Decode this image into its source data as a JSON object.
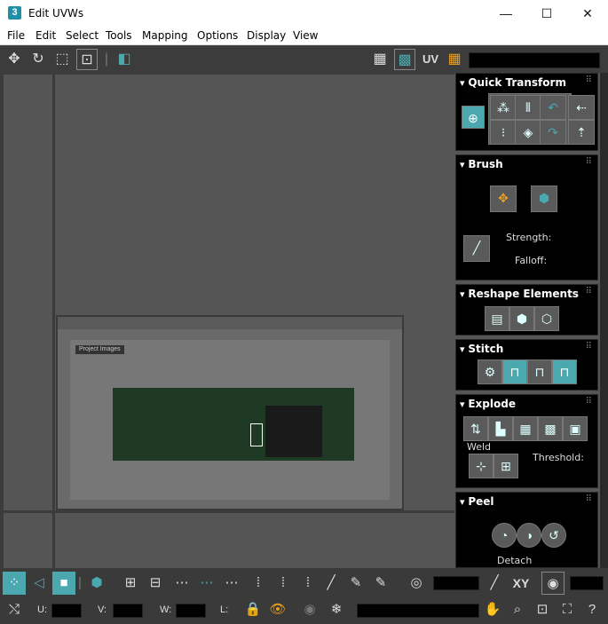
{
  "window": {
    "app_icon": "3",
    "title": "Edit UVWs",
    "minimize": "—",
    "maximize": "☐",
    "close": "✕"
  },
  "menu": [
    "File",
    "Edit",
    "Select",
    "Tools",
    "Mapping",
    "Options",
    "Display",
    "View"
  ],
  "toolbar": {
    "uv_label": "UV"
  },
  "viewport": {
    "image_tab_label": "Project Images"
  },
  "panels": {
    "quick_transform": {
      "title": "Quick Transform"
    },
    "brush": {
      "title": "Brush",
      "strength_label": "Strength:",
      "falloff_label": "Falloff:"
    },
    "reshape": {
      "title": "Reshape Elements"
    },
    "stitch": {
      "title": "Stitch"
    },
    "explode": {
      "title": "Explode",
      "weld_label": "Weld",
      "threshold_label": "Threshold:"
    },
    "peel": {
      "title": "Peel",
      "detach_label": "Detach"
    }
  },
  "bottom": {
    "xy_label": "XY",
    "u_label": "U:",
    "v_label": "V:",
    "w_label": "W:",
    "l_label": "L:"
  },
  "colors": {
    "accent": "#4aa8ae",
    "panel_bg": "#000000",
    "viewport_bg": "#555555"
  }
}
